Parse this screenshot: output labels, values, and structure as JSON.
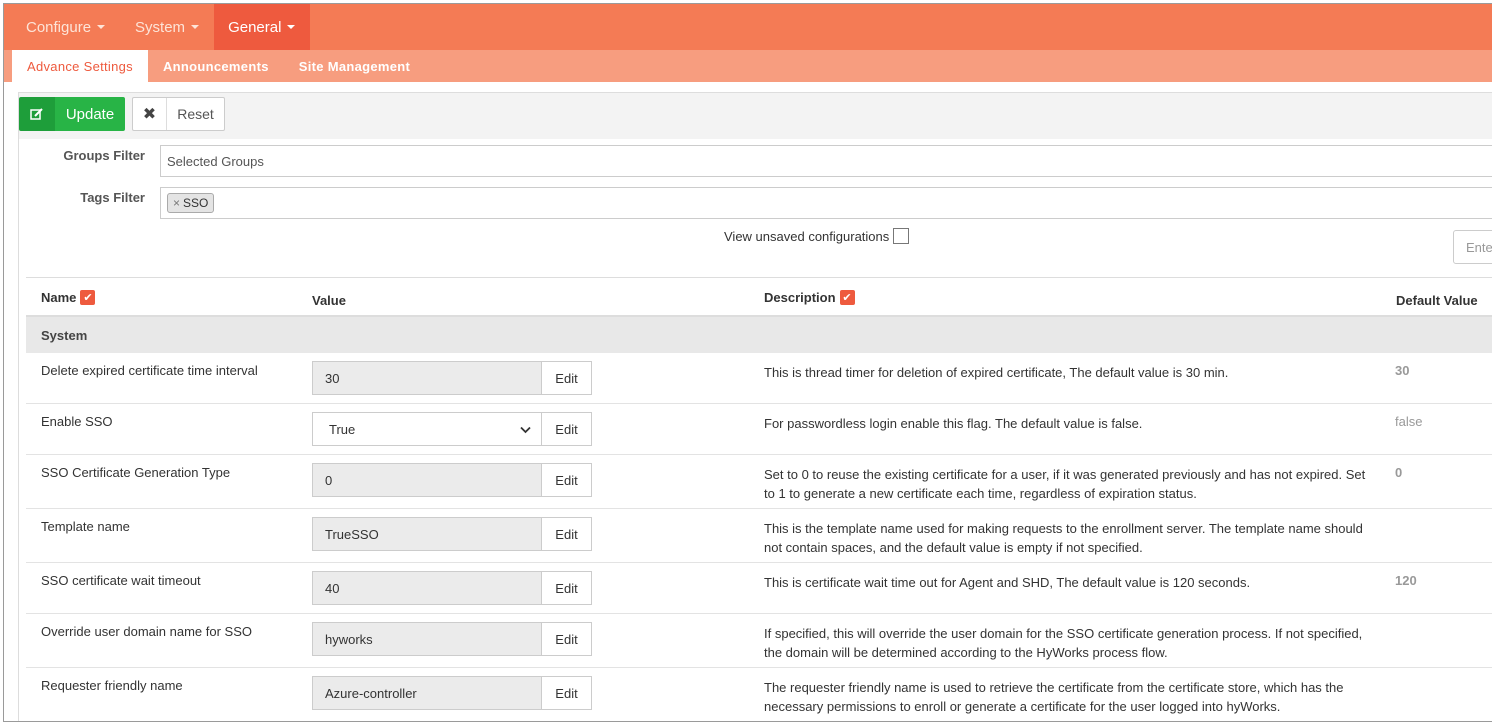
{
  "nav": {
    "items": [
      {
        "label": "Configure",
        "active": false
      },
      {
        "label": "System",
        "active": false
      },
      {
        "label": "General",
        "active": true
      }
    ]
  },
  "subnav": {
    "items": [
      {
        "label": "Advance Settings",
        "active": true
      },
      {
        "label": "Announcements",
        "active": false
      },
      {
        "label": "Site Management",
        "active": false
      }
    ]
  },
  "toolbar": {
    "update_label": "Update",
    "reset_label": "Reset"
  },
  "filters": {
    "groups_label": "Groups Filter",
    "groups_value": "Selected Groups",
    "tags_label": "Tags Filter",
    "tags": [
      "SSO"
    ],
    "tag_remove": "×"
  },
  "unsaved_label": "View unsaved configurations",
  "search_placeholder": "Enter",
  "table": {
    "headers": {
      "name": "Name",
      "value": "Value",
      "description": "Description",
      "default": "Default Value"
    },
    "group": "System",
    "edit_label": "Edit",
    "rows": [
      {
        "name": "Delete expired certificate time interval",
        "value": "30",
        "type": "text",
        "description": "This is thread timer for deletion of expired certificate, The default value is 30 min.",
        "default": "30"
      },
      {
        "name": "Enable SSO",
        "value": "True",
        "type": "select",
        "description": "For passwordless login enable this flag. The default value is false.",
        "default": "false"
      },
      {
        "name": "SSO Certificate Generation Type",
        "value": "0",
        "type": "text",
        "description": "Set to 0 to reuse the existing certificate for a user, if it was generated previously and has not expired. Set to 1 to generate a new certificate each time, regardless of expiration status.",
        "default": "0"
      },
      {
        "name": "Template name",
        "value": "TrueSSO",
        "type": "text",
        "description": "This is the template name used for making requests to the enrollment server. The template name should not contain spaces, and the default value is empty if not specified.",
        "default": ""
      },
      {
        "name": "SSO certificate wait timeout",
        "value": "40",
        "type": "text",
        "description": "This is certificate wait time out for Agent and SHD, The default value is 120 seconds.",
        "default": "120"
      },
      {
        "name": "Override user domain name for SSO",
        "value": "hyworks",
        "type": "text",
        "description": "If specified, this will override the user domain for the SSO certificate generation process. If not specified, the domain will be determined according to the HyWorks process flow.",
        "default": ""
      },
      {
        "name": "Requester friendly name",
        "value": "Azure-controller",
        "type": "text",
        "description": "The requester friendly name is used to retrieve the certificate from the certificate store, which has the necessary permissions to enroll or generate a certificate for the user logged into hyWorks.",
        "default": ""
      }
    ]
  },
  "colors": {
    "topnav": "#f47b55",
    "topnav_active": "#ee5a3e",
    "subnav": "#f79d7f",
    "update_button": "#28b446",
    "accent": "#ee5a3e"
  }
}
